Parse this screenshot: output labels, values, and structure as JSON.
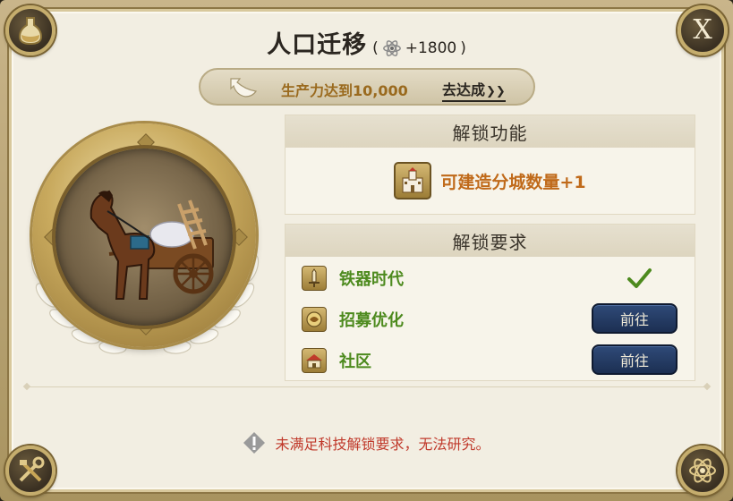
{
  "dialog": {
    "title": "人口迁移",
    "bonus_open": "(",
    "bonus_value": "+1800",
    "bonus_close": ")",
    "close_label": "X"
  },
  "goal": {
    "text": "生产力达到10,000",
    "link_label": "去达成",
    "link_chevron": "❯❯"
  },
  "unlock_function": {
    "header": "解锁功能",
    "item_label": "可建造分城数量+1",
    "item_icon": "castle-icon"
  },
  "unlock_requirements": {
    "header": "解锁要求",
    "items": [
      {
        "label": "铁器时代",
        "icon": "sword-icon",
        "status": "done"
      },
      {
        "label": "招募优化",
        "icon": "recruit-icon",
        "status": "pending",
        "button": "前往"
      },
      {
        "label": "社区",
        "icon": "community-icon",
        "status": "pending",
        "button": "前往"
      }
    ]
  },
  "warning": {
    "text": "未满足科技解锁要求，无法研究。"
  },
  "colors": {
    "accent_orange": "#c06a1a",
    "requirement_green": "#4d8a1e",
    "button_blue": "#1c2f52",
    "warning_red": "#c0392b"
  }
}
